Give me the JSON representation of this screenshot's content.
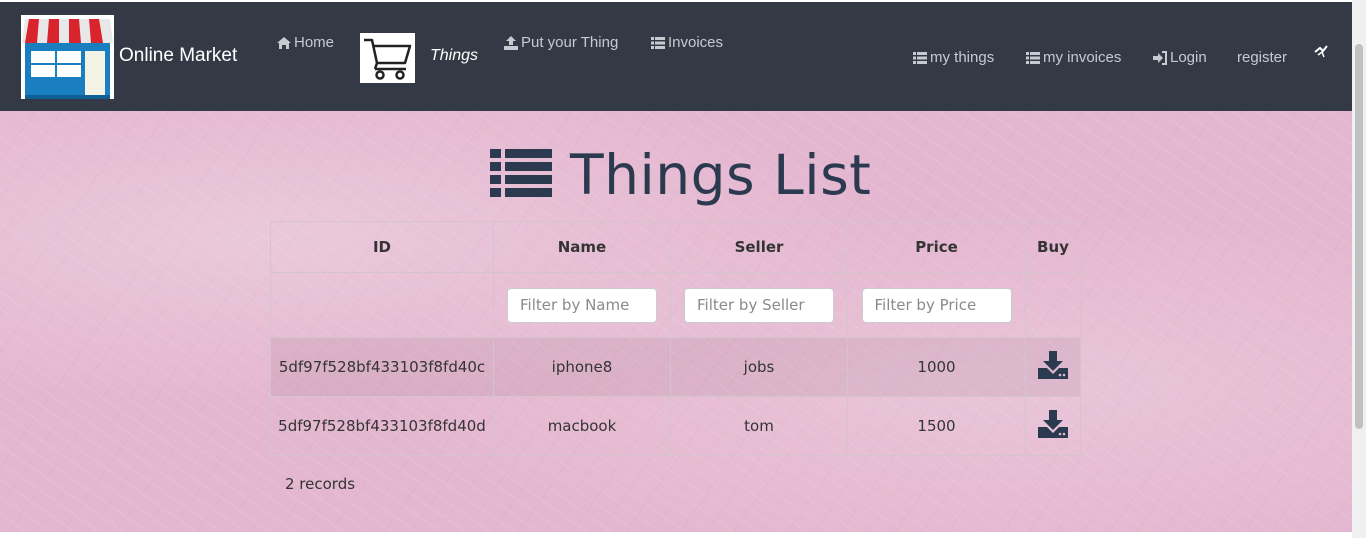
{
  "navbar": {
    "brand_name": "Online Market",
    "left_links": [
      {
        "label": "Home",
        "icon": "home-icon"
      },
      {
        "label": "Things",
        "icon": "shopping-cart-icon"
      },
      {
        "label": "Put your Thing",
        "icon": "upload-icon"
      },
      {
        "label": "Invoices",
        "icon": "list-icon"
      }
    ],
    "right_links": [
      {
        "label": "my things",
        "icon": "list-icon"
      },
      {
        "label": "my invoices",
        "icon": "list-icon"
      },
      {
        "label": "Login",
        "icon": "login-icon"
      },
      {
        "label": "register",
        "icon": "broken-image-icon"
      }
    ],
    "bg_color": "#343a45"
  },
  "main": {
    "title": "Things List",
    "title_icon": "list-icon",
    "table": {
      "columns": [
        "ID",
        "Name",
        "Seller",
        "Price",
        "Buy"
      ],
      "filters": {
        "name_placeholder": "Filter by Name",
        "seller_placeholder": "Filter by Seller",
        "price_placeholder": "Filter by Price"
      },
      "rows": [
        {
          "id": "5df97f528bf433103f8fd40c",
          "name": "iphone8",
          "seller": "jobs",
          "price": "1000",
          "buy_icon": "download-icon"
        },
        {
          "id": "5df97f528bf433103f8fd40d",
          "name": "macbook",
          "seller": "tom",
          "price": "1500",
          "buy_icon": "download-icon"
        }
      ]
    },
    "records_text": "2 records"
  }
}
